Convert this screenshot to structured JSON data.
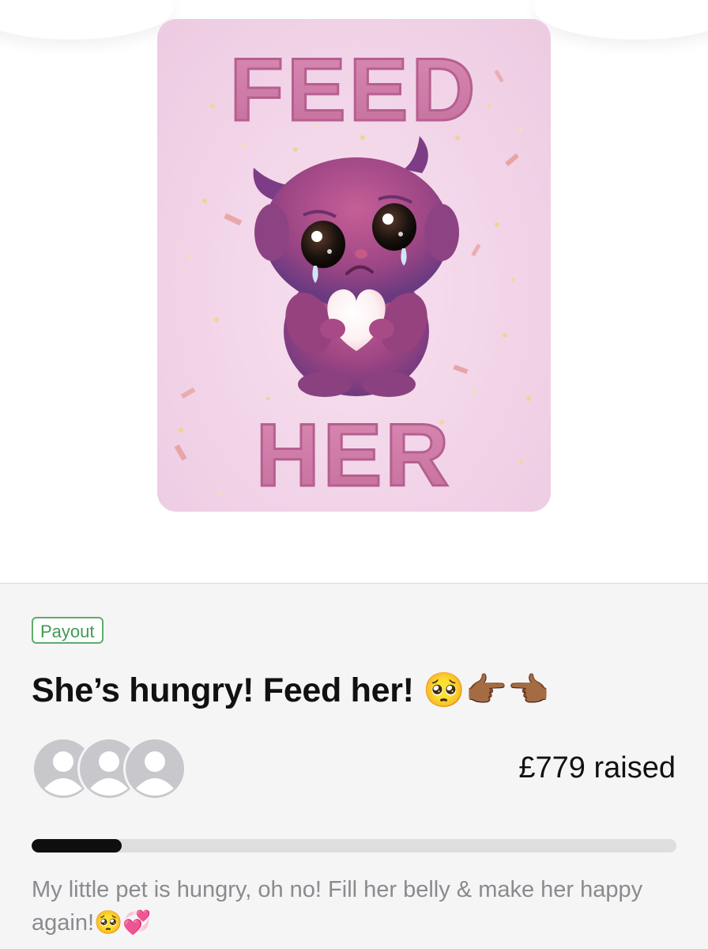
{
  "poster": {
    "line1": "FEED",
    "line2": "HER"
  },
  "campaign": {
    "badge": "Payout",
    "title": "She’s hungry! Feed her! 🥺👉🏾👈🏾",
    "raised": "£779 raised",
    "progress_fraction": 0.14,
    "description": "My little pet is hungry, oh no! Fill her belly & make her happy again!🥺💞"
  },
  "avatars": [
    {
      "icon": "person-placeholder-icon"
    },
    {
      "icon": "person-placeholder-icon"
    },
    {
      "icon": "person-placeholder-icon"
    }
  ],
  "colors": {
    "badge_green": "#5cad6d",
    "progress_fill": "#0f0f0f",
    "progress_track": "#dedee1",
    "poster_pink": "#f2d4e8",
    "monster_purple": "#a24a86"
  }
}
